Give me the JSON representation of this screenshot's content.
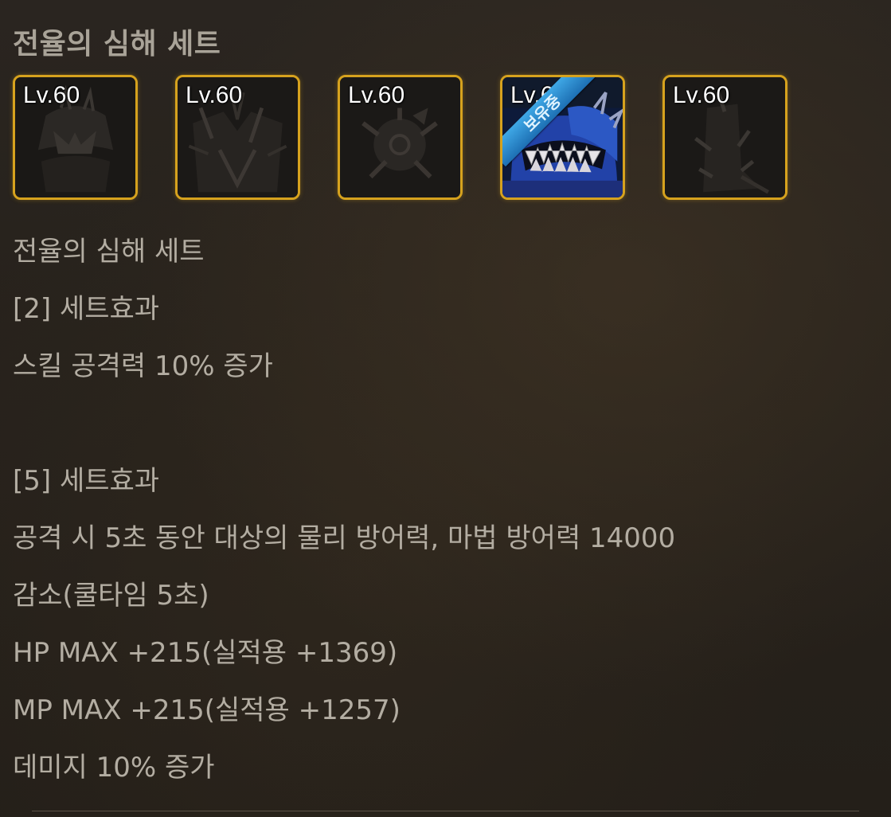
{
  "set_header": "전율의 심해 세트",
  "items": [
    {
      "level": "Lv.60",
      "icon": "helmet-icon",
      "owned": false
    },
    {
      "level": "Lv.60",
      "icon": "armor-icon",
      "owned": false
    },
    {
      "level": "Lv.60",
      "icon": "shoulder-icon",
      "owned": false
    },
    {
      "level": "Lv.60",
      "icon": "monster-glove-icon",
      "owned": true,
      "badge": "보유중"
    },
    {
      "level": "Lv.60",
      "icon": "boots-icon",
      "owned": false
    }
  ],
  "description": {
    "set_name": "전율의 심해 세트",
    "effect2_title": "[2] 세트효과",
    "effect2_line1": "스킬 공격력 10% 증가",
    "effect5_title": "[5] 세트효과",
    "effect5_line1": "공격 시 5초 동안 대상의 물리 방어력, 마법 방어력 14000",
    "effect5_line2": "감소(쿨타임 5초)",
    "effect5_line3": "HP MAX +215(실적용 +1369)",
    "effect5_line4": "MP MAX +215(실적용 +1257)",
    "effect5_line5": "데미지 10% 증가"
  },
  "colors": {
    "frame_gold": "#d6a21e",
    "owned_badge_blue": "#2f8fd4",
    "text": "#b3ada2"
  }
}
